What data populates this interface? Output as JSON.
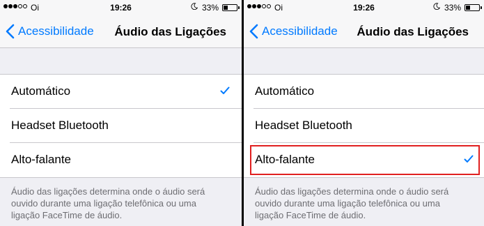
{
  "screens": [
    {
      "status": {
        "carrier": "Oi",
        "time": "19:26",
        "battery": "33%",
        "battery_level": 0.33,
        "signal_bars_filled": 3,
        "signal_bars_total": 5
      },
      "nav": {
        "back_label": "Acessibilidade",
        "title": "Áudio das Ligações"
      },
      "options": [
        {
          "label": "Automático",
          "selected": true
        },
        {
          "label": "Headset Bluetooth",
          "selected": false
        },
        {
          "label": "Alto-falante",
          "selected": false
        }
      ],
      "footer_lines": [
        "Áudio das ligações determina onde o áudio será",
        "ouvido durante uma ligação telefônica ou uma",
        "ligação FaceTime de áudio."
      ]
    },
    {
      "status": {
        "carrier": "Oi",
        "time": "19:26",
        "battery": "33%",
        "battery_level": 0.33,
        "signal_bars_filled": 3,
        "signal_bars_total": 5
      },
      "nav": {
        "back_label": "Acessibilidade",
        "title": "Áudio das Ligações"
      },
      "options": [
        {
          "label": "Automático",
          "selected": false
        },
        {
          "label": "Headset Bluetooth",
          "selected": false
        },
        {
          "label": "Alto-falante",
          "selected": true,
          "highlighted": true
        }
      ],
      "footer_lines": [
        "Áudio das ligações determina onde o áudio será",
        "ouvido durante uma ligação telefônica ou uma",
        "ligação FaceTime de áudio."
      ]
    }
  ],
  "colors": {
    "accent": "#007aff",
    "highlight_border": "#e02020",
    "background": "#efeff4",
    "footer_text": "#6d6d72"
  },
  "icons": {
    "back": "chevron-left-icon",
    "selected": "checkmark-icon",
    "do_not_disturb": "moon-icon",
    "battery": "battery-icon"
  }
}
